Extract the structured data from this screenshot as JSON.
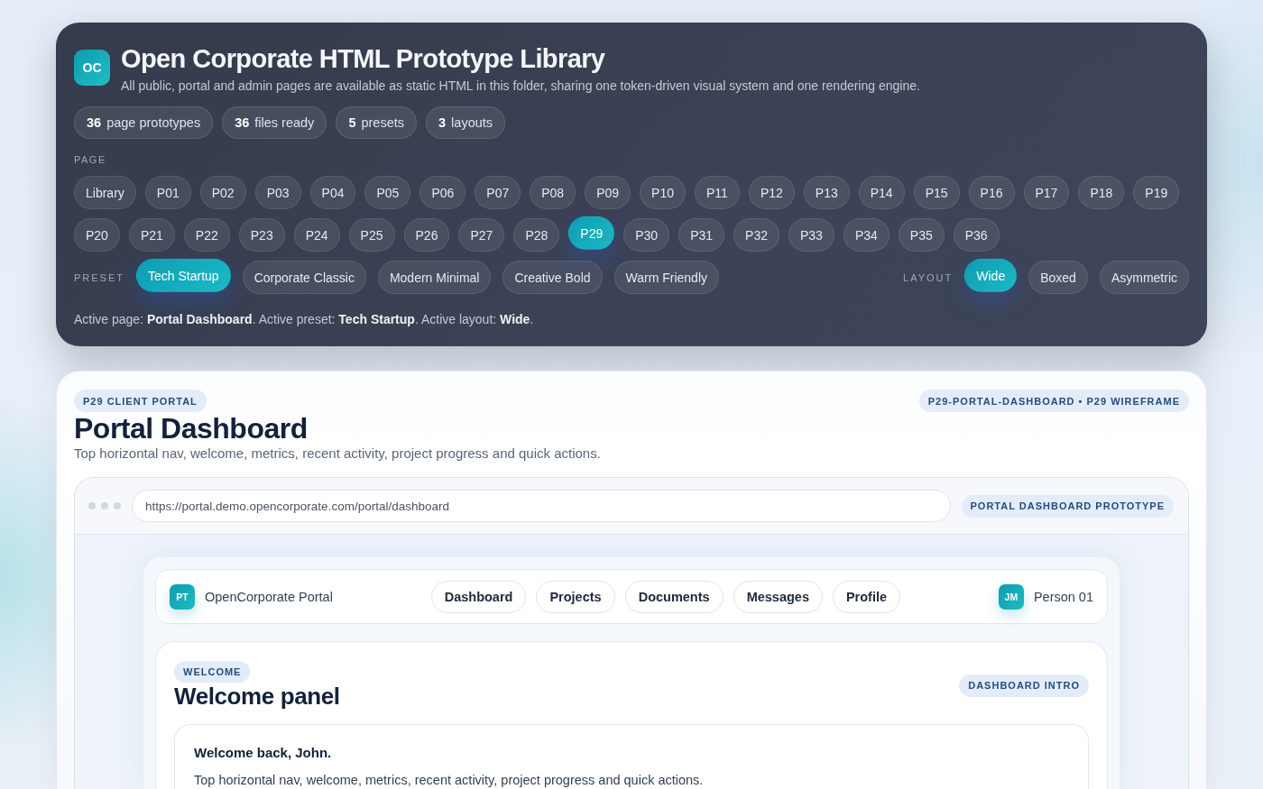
{
  "header": {
    "logo": "OC",
    "title": "Open Corporate HTML Prototype Library",
    "subtitle": "All public, portal and admin pages are available as static HTML in this folder, sharing one token-driven visual system and one rendering engine."
  },
  "stats": [
    {
      "value": "36",
      "label": "page prototypes"
    },
    {
      "value": "36",
      "label": "files ready"
    },
    {
      "value": "5",
      "label": "presets"
    },
    {
      "value": "3",
      "label": "layouts"
    }
  ],
  "page_picker": {
    "label": "PAGE",
    "items": [
      {
        "label": "Library",
        "selected": false
      },
      {
        "label": "P01",
        "selected": false
      },
      {
        "label": "P02",
        "selected": false
      },
      {
        "label": "P03",
        "selected": false
      },
      {
        "label": "P04",
        "selected": false
      },
      {
        "label": "P05",
        "selected": false
      },
      {
        "label": "P06",
        "selected": false
      },
      {
        "label": "P07",
        "selected": false
      },
      {
        "label": "P08",
        "selected": false
      },
      {
        "label": "P09",
        "selected": false
      },
      {
        "label": "P10",
        "selected": false
      },
      {
        "label": "P11",
        "selected": false
      },
      {
        "label": "P12",
        "selected": false
      },
      {
        "label": "P13",
        "selected": false
      },
      {
        "label": "P14",
        "selected": false
      },
      {
        "label": "P15",
        "selected": false
      },
      {
        "label": "P16",
        "selected": false
      },
      {
        "label": "P17",
        "selected": false
      },
      {
        "label": "P18",
        "selected": false
      },
      {
        "label": "P19",
        "selected": false
      },
      {
        "label": "P20",
        "selected": false
      },
      {
        "label": "P21",
        "selected": false
      },
      {
        "label": "P22",
        "selected": false
      },
      {
        "label": "P23",
        "selected": false
      },
      {
        "label": "P24",
        "selected": false
      },
      {
        "label": "P25",
        "selected": false
      },
      {
        "label": "P26",
        "selected": false
      },
      {
        "label": "P27",
        "selected": false
      },
      {
        "label": "P28",
        "selected": false
      },
      {
        "label": "P29",
        "selected": true
      },
      {
        "label": "P30",
        "selected": false
      },
      {
        "label": "P31",
        "selected": false
      },
      {
        "label": "P32",
        "selected": false
      },
      {
        "label": "P33",
        "selected": false
      },
      {
        "label": "P34",
        "selected": false
      },
      {
        "label": "P35",
        "selected": false
      },
      {
        "label": "P36",
        "selected": false
      }
    ]
  },
  "preset_picker": {
    "label": "PRESET",
    "items": [
      {
        "label": "Tech Startup",
        "selected": true
      },
      {
        "label": "Corporate Classic",
        "selected": false
      },
      {
        "label": "Modern Minimal",
        "selected": false
      },
      {
        "label": "Creative Bold",
        "selected": false
      },
      {
        "label": "Warm Friendly",
        "selected": false
      }
    ]
  },
  "layout_picker": {
    "label": "LAYOUT",
    "items": [
      {
        "label": "Wide",
        "selected": true
      },
      {
        "label": "Boxed",
        "selected": false
      },
      {
        "label": "Asymmetric",
        "selected": false
      }
    ]
  },
  "status": "Active page: **Portal Dashboard**. Active preset: **Tech Startup**. Active layout: **Wide**.",
  "preview": {
    "tag": "P29 CLIENT PORTAL",
    "meta": "P29-PORTAL-DASHBOARD • P29 WIREFRAME",
    "title": "Portal Dashboard",
    "subtitle": "Top horizontal nav, welcome, metrics, recent activity, project progress and quick actions.",
    "browser": {
      "url": "https://portal.demo.opencorporate.com/portal/dashboard",
      "badge": "PORTAL DASHBOARD PROTOTYPE",
      "portal_nav": {
        "logo": "PT",
        "brand": "OpenCorporate Portal",
        "links": [
          "Dashboard",
          "Projects",
          "Documents",
          "Messages",
          "Profile"
        ],
        "user": {
          "initials": "JM",
          "name": "Person 01"
        }
      },
      "welcome": {
        "tag": "WELCOME",
        "title": "Welcome panel",
        "badge": "DASHBOARD INTRO",
        "greeting": "Welcome back, John.",
        "text": "Top horizontal nav, welcome, metrics, recent activity, project progress and quick actions."
      }
    }
  }
}
